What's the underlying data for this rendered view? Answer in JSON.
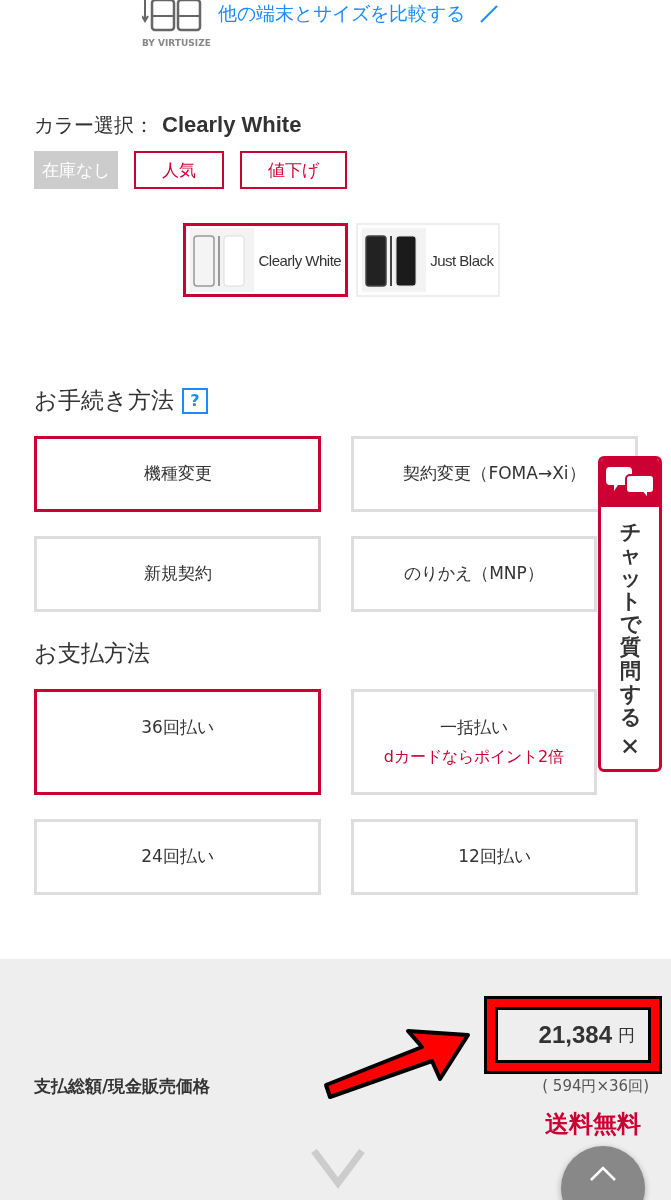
{
  "compare_link": {
    "label": "他の端末とサイズを比較する",
    "brand": "BY VIRTUSIZE"
  },
  "color_select": {
    "label": "カラー選択：",
    "value": "Clearly White",
    "badges": [
      {
        "label": "在庫なし",
        "kind": "disabled"
      },
      {
        "label": "人気",
        "kind": "outline"
      },
      {
        "label": "値下げ",
        "kind": "outline"
      }
    ],
    "options": [
      {
        "label": "Clearly White",
        "kind": "white",
        "selected": true
      },
      {
        "label": "Just Black",
        "kind": "black",
        "selected": false
      }
    ]
  },
  "procedure": {
    "title": "お手続き方法",
    "help": "?",
    "options": [
      {
        "label": "機種変更",
        "selected": true
      },
      {
        "label": "契約変更（FOMA→Xi）",
        "selected": false
      },
      {
        "label": "新規契約",
        "selected": false
      },
      {
        "label": "のりかえ（MNP）",
        "selected": false
      }
    ]
  },
  "payment": {
    "title": "お支払方法",
    "options": [
      {
        "label": "36回払い",
        "selected": true
      },
      {
        "label": "一括払い",
        "note": "dカードならポイント2倍",
        "selected": false
      },
      {
        "label": "24回払い",
        "selected": false
      },
      {
        "label": "12回払い",
        "selected": false
      }
    ]
  },
  "total": {
    "label": "支払総額/現金販売価格",
    "amount": "21,384",
    "unit": "円",
    "monthly": "( 594円×36回)",
    "shipping": "送料無料"
  },
  "chat": {
    "label": "チャットで質問する",
    "close": "✕"
  }
}
